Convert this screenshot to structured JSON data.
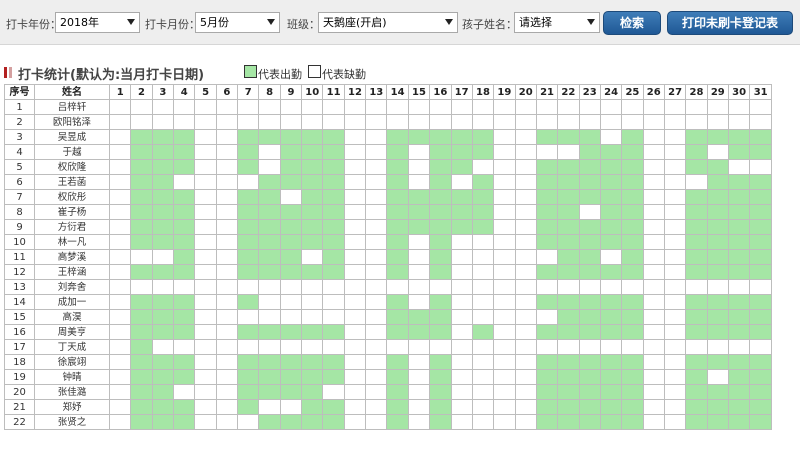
{
  "filters": {
    "year_label": "打卡年份：",
    "year_value": "2018年",
    "month_label": "打卡月份：",
    "month_value": "5月份",
    "class_label": "班级：",
    "class_value": "天鹅座(开启)",
    "child_label": "孩子姓名：",
    "child_value": "请选择",
    "search_button": "检索",
    "print_button": "打印未刷卡登记表"
  },
  "section": {
    "title": "打卡统计(默认为:当月打卡日期)",
    "legend_present": "代表出勤",
    "legend_absent": "代表缺勤"
  },
  "colors": {
    "present": "#a5e6a5",
    "absent": "#ffffff",
    "accent": "#2a67a6",
    "title_mark": "#b32020"
  },
  "table": {
    "col_index": "序号",
    "col_name": "姓名",
    "days": [
      "1",
      "2",
      "3",
      "4",
      "5",
      "6",
      "7",
      "8",
      "9",
      "10",
      "11",
      "12",
      "13",
      "14",
      "15",
      "16",
      "17",
      "18",
      "19",
      "20",
      "21",
      "22",
      "23",
      "24",
      "25",
      "26",
      "27",
      "28",
      "29",
      "30",
      "31"
    ],
    "rows": [
      {
        "no": "1",
        "name": "吕梓轩",
        "present": []
      },
      {
        "no": "2",
        "name": "欧阳铭泽",
        "present": []
      },
      {
        "no": "3",
        "name": "吴昱成",
        "present": [
          2,
          3,
          4,
          7,
          8,
          9,
          10,
          11,
          14,
          15,
          16,
          17,
          18,
          21,
          22,
          23,
          25,
          28,
          29,
          30,
          31
        ]
      },
      {
        "no": "4",
        "name": "于越",
        "present": [
          2,
          3,
          4,
          7,
          9,
          10,
          11,
          14,
          16,
          17,
          18,
          23,
          24,
          25,
          28,
          30,
          31
        ]
      },
      {
        "no": "5",
        "name": "权欣隆",
        "present": [
          2,
          3,
          4,
          7,
          9,
          10,
          11,
          14,
          16,
          17,
          21,
          22,
          23,
          24,
          25,
          28,
          29
        ]
      },
      {
        "no": "6",
        "name": "王若菡",
        "present": [
          2,
          3,
          8,
          9,
          10,
          11,
          14,
          16,
          18,
          21,
          22,
          23,
          24,
          25,
          29,
          30,
          31
        ]
      },
      {
        "no": "7",
        "name": "权欣彤",
        "present": [
          2,
          3,
          4,
          7,
          8,
          10,
          11,
          14,
          15,
          16,
          17,
          18,
          21,
          22,
          23,
          24,
          25,
          28,
          29,
          30,
          31
        ]
      },
      {
        "no": "8",
        "name": "崔子杨",
        "present": [
          2,
          3,
          4,
          7,
          8,
          9,
          10,
          11,
          14,
          15,
          16,
          17,
          18,
          21,
          22,
          24,
          25,
          28,
          29,
          30,
          31
        ]
      },
      {
        "no": "9",
        "name": "方衍君",
        "present": [
          2,
          3,
          4,
          7,
          8,
          9,
          10,
          11,
          14,
          15,
          16,
          17,
          18,
          21,
          22,
          23,
          24,
          25,
          28,
          29,
          30,
          31
        ]
      },
      {
        "no": "10",
        "name": "林一凡",
        "present": [
          2,
          3,
          4,
          7,
          8,
          9,
          10,
          11,
          14,
          16,
          21,
          22,
          23,
          24,
          25,
          28,
          29,
          30,
          31
        ]
      },
      {
        "no": "11",
        "name": "高梦溪",
        "present": [
          4,
          7,
          8,
          9,
          11,
          14,
          16,
          22,
          23,
          25,
          28,
          29,
          30,
          31
        ]
      },
      {
        "no": "12",
        "name": "王梓涵",
        "present": [
          2,
          3,
          4,
          7,
          8,
          9,
          10,
          11,
          14,
          16,
          21,
          22,
          23,
          24,
          25,
          28,
          29,
          30,
          31
        ]
      },
      {
        "no": "13",
        "name": "刘奔舍",
        "present": []
      },
      {
        "no": "14",
        "name": "成加一",
        "present": [
          2,
          3,
          4,
          7,
          14,
          16,
          21,
          22,
          23,
          24,
          25,
          28,
          29,
          30,
          31
        ]
      },
      {
        "no": "15",
        "name": "高淏",
        "present": [
          2,
          3,
          4,
          14,
          15,
          16,
          22,
          23,
          24,
          25,
          28,
          29,
          30,
          31
        ]
      },
      {
        "no": "16",
        "name": "周美亨",
        "present": [
          2,
          3,
          4,
          7,
          8,
          9,
          10,
          11,
          14,
          15,
          16,
          18,
          21,
          22,
          23,
          24,
          25,
          28,
          29,
          30,
          31
        ]
      },
      {
        "no": "17",
        "name": "丁天成",
        "present": [
          2
        ]
      },
      {
        "no": "18",
        "name": "徐宸翊",
        "present": [
          2,
          3,
          4,
          7,
          8,
          9,
          10,
          11,
          14,
          16,
          21,
          22,
          23,
          24,
          25,
          28,
          29,
          30,
          31
        ]
      },
      {
        "no": "19",
        "name": "钟晴",
        "present": [
          2,
          3,
          4,
          7,
          8,
          9,
          10,
          11,
          14,
          16,
          21,
          22,
          23,
          24,
          25,
          28,
          30,
          31
        ]
      },
      {
        "no": "20",
        "name": "张佳潞",
        "present": [
          2,
          3,
          7,
          8,
          9,
          10,
          14,
          16,
          21,
          22,
          23,
          24,
          25,
          28,
          29,
          30,
          31
        ]
      },
      {
        "no": "21",
        "name": "郑妤",
        "present": [
          2,
          3,
          4,
          7,
          10,
          11,
          14,
          16,
          21,
          22,
          23,
          24,
          25,
          28,
          29,
          30,
          31
        ]
      },
      {
        "no": "22",
        "name": "张贤之",
        "present": [
          2,
          3,
          4,
          8,
          9,
          10,
          11,
          14,
          16,
          21,
          22,
          23,
          24,
          25,
          28,
          29,
          30,
          31
        ]
      }
    ]
  }
}
